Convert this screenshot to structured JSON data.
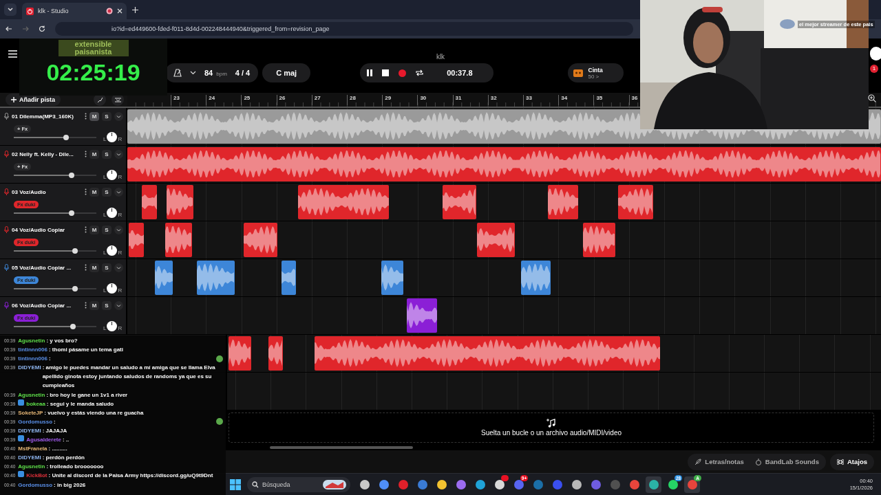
{
  "browser": {
    "tab": {
      "title": "klk - Studio"
    },
    "url": "io?id=ed449600-fded-f011-8d4d-002248444940&triggered_from=revision_page"
  },
  "stream_overlay": {
    "logo": "extensible paisanista",
    "timer": "02:25:19"
  },
  "webcam": {
    "kind": "picture",
    "caption": "el mejor streamer de este pais"
  },
  "header": {
    "title": "klk",
    "notification_count": "1"
  },
  "toolbar": {
    "tempo": "84",
    "tempo_unit": "bpm",
    "time_signature": "4 / 4",
    "key": "C maj",
    "position": "00:37.8",
    "tape": {
      "label": "Cinta",
      "count": "50 >"
    }
  },
  "add_track": "Añadir pista",
  "ruler": [
    "23",
    "24",
    "25",
    "26",
    "27",
    "28",
    "29",
    "30",
    "31",
    "32",
    "33",
    "34",
    "35",
    "36"
  ],
  "tracks": [
    {
      "kind": "full",
      "number": "01",
      "name": "Dilemma(MP3_160K)",
      "color": "#9a9a9a",
      "fx": {
        "label": "+ Fx",
        "kind": "plain"
      },
      "mute_label": "M",
      "solo_label": "S",
      "mute": true,
      "level": 0.63,
      "pan": [
        "L",
        "R"
      ]
    },
    {
      "kind": "full",
      "number": "02",
      "name": "Nelly ft. Kelly - Dile...",
      "color": "#e0262b",
      "fx": {
        "label": "+ Fx",
        "kind": "plain"
      },
      "mute_label": "M",
      "solo_label": "S",
      "mute": false,
      "level": 0.7,
      "pan": [
        "L",
        "R"
      ]
    },
    {
      "kind": "full",
      "number": "03",
      "name": "Voz/Audio",
      "color": "#e0262b",
      "fx": {
        "label": "Fx duki",
        "kind": "colored"
      },
      "mute_label": "M",
      "solo_label": "S",
      "mute": false,
      "level": 0.7,
      "pan": [
        "L",
        "R"
      ]
    },
    {
      "kind": "full",
      "number": "04",
      "name": "Voz/Audio Copiar",
      "color": "#e0262b",
      "fx": {
        "label": "Fx duki",
        "kind": "colored"
      },
      "mute_label": "M",
      "solo_label": "S",
      "mute": false,
      "level": 0.74,
      "pan": [
        "L",
        "R"
      ]
    },
    {
      "kind": "full",
      "number": "05",
      "name": "Voz/Audio Copiar ...",
      "color": "#3d86d8",
      "fx": {
        "label": "Fx duki",
        "kind": "colored"
      },
      "mute_label": "M",
      "solo_label": "S",
      "mute": false,
      "level": 0.74,
      "pan": [
        "L",
        "R"
      ]
    },
    {
      "kind": "full",
      "number": "06",
      "name": "Voz/Audio Copiar ...",
      "color": "#8b1fd6",
      "fx": {
        "label": "Fx duki",
        "kind": "colored"
      },
      "mute_label": "M",
      "solo_label": "S",
      "mute": false,
      "level": 0.72,
      "pan": [
        "L",
        "R"
      ]
    },
    {
      "kind": "covered",
      "color": "#e0262b"
    },
    {
      "kind": "covered"
    }
  ],
  "drop_zone": "Suelta un bucle o un archivo audio/MIDI/video",
  "bottom_bar": [
    {
      "label": "Letras/notas",
      "kind": "lyrics"
    },
    {
      "label": "BandLab Sounds",
      "kind": "sounds"
    },
    {
      "label": "Atajos",
      "kind": "shortcuts"
    }
  ],
  "chat": [
    {
      "time": "00:39",
      "user": "Agusnetin",
      "color": "#5fe04a",
      "kind": "text",
      "text": ": y vos bro?",
      "badge": false
    },
    {
      "time": "00:39",
      "user": "tintinnn006",
      "color": "#5a8fe8",
      "kind": "text",
      "text": ": thomi pásame un tema gati",
      "badge": false
    },
    {
      "time": "00:39",
      "user": "tintinnn006",
      "color": "#5a8fe8",
      "kind": "emote",
      "text": ":",
      "badge": false
    },
    {
      "time": "00:39",
      "user": "DIDYEMI",
      "color": "#8fb6f0",
      "kind": "text",
      "text": ": amigo le puedes mandar un saludo a mí amiga que se llama Elva apellido ginota estoy juntando saludos de randoms ya que es su cumpleaños",
      "badge": false
    },
    {
      "time": "00:39",
      "user": "Agusnetin",
      "color": "#5fe04a",
      "kind": "text",
      "text": ": bro hoy le gane un 1v1 a river",
      "badge": false
    },
    {
      "time": "00:39",
      "user": "bokeaa",
      "color": "#5fe04a",
      "kind": "text",
      "text": ": segui y le manda saludo",
      "badge": true
    },
    {
      "time": "00:39",
      "user": "SoketeJP",
      "color": "#e8b877",
      "kind": "text",
      "text": ": vuelvo y estás viendo una re guacha",
      "badge": false
    },
    {
      "time": "00:39",
      "user": "Gordomusso",
      "color": "#5a8fe8",
      "kind": "emote",
      "text": ":",
      "badge": false
    },
    {
      "time": "00:39",
      "user": "DIDYEMI",
      "color": "#8fb6f0",
      "kind": "text",
      "text": ": JAJAJA",
      "badge": false
    },
    {
      "time": "00:39",
      "user": "Agusalderete",
      "color": "#a35cf0",
      "kind": "text",
      "text": ": ..",
      "badge": true
    },
    {
      "time": "00:40",
      "user": "MstFranela",
      "color": "#e8b877",
      "kind": "text",
      "text": ": ..........",
      "badge": false
    },
    {
      "time": "00:40",
      "user": "DIDYEMI",
      "color": "#8fb6f0",
      "kind": "text",
      "text": ": perdón perdón",
      "badge": false
    },
    {
      "time": "00:40",
      "user": "Agusnetin",
      "color": "#5fe04a",
      "kind": "text",
      "text": ": trolleado brooooooo",
      "badge": false
    },
    {
      "time": "00:40",
      "user": "KickBot",
      "color": "#e0303a",
      "kind": "text",
      "text": ": Unite al discord de la Paisa Army https://discord.gg/uQ9t9Dnt",
      "badge": true
    },
    {
      "time": "00:40",
      "user": "Gordomusso",
      "color": "#5a8fe8",
      "kind": "text",
      "text": ": in big 2026",
      "badge": false
    }
  ],
  "taskbar": {
    "search": {
      "placeholder": "Búsqueda"
    },
    "apps": [
      {
        "color": "#c8c8c8",
        "selected": false
      },
      {
        "color": "#4f8ef7",
        "selected": false
      },
      {
        "color": "#e0202a",
        "selected": false
      },
      {
        "color": "#3a7bd5",
        "selected": false
      },
      {
        "color": "#f2c230",
        "selected": false
      },
      {
        "color": "#9b6cf0",
        "selected": false
      },
      {
        "color": "#1fa3d8",
        "selected": false
      },
      {
        "color": "#d8d8d8",
        "selected": false,
        "badge": {
          "color": "#e81123"
        }
      },
      {
        "color": "#5865f2",
        "selected": false,
        "badge": {
          "text": "9+",
          "color": "#e81123"
        }
      },
      {
        "color": "#1b6fa8",
        "selected": false
      },
      {
        "color": "#3a4ff0",
        "selected": false
      },
      {
        "color": "#b8b8b8",
        "selected": false
      },
      {
        "color": "#6f5ce0",
        "selected": false
      },
      {
        "color": "#505050",
        "selected": false
      },
      {
        "color": "#e8453c",
        "selected": false
      },
      {
        "color": "#2bb3a6",
        "selected": true
      },
      {
        "color": "#25d366",
        "selected": false,
        "badge": {
          "text": "28",
          "color": "#2a8ee0"
        }
      },
      {
        "color": "#e8453c",
        "selected": true,
        "badge": {
          "text": "A",
          "color": "#3fae49"
        }
      }
    ],
    "time": "00:40",
    "date": "15/1/2026"
  }
}
